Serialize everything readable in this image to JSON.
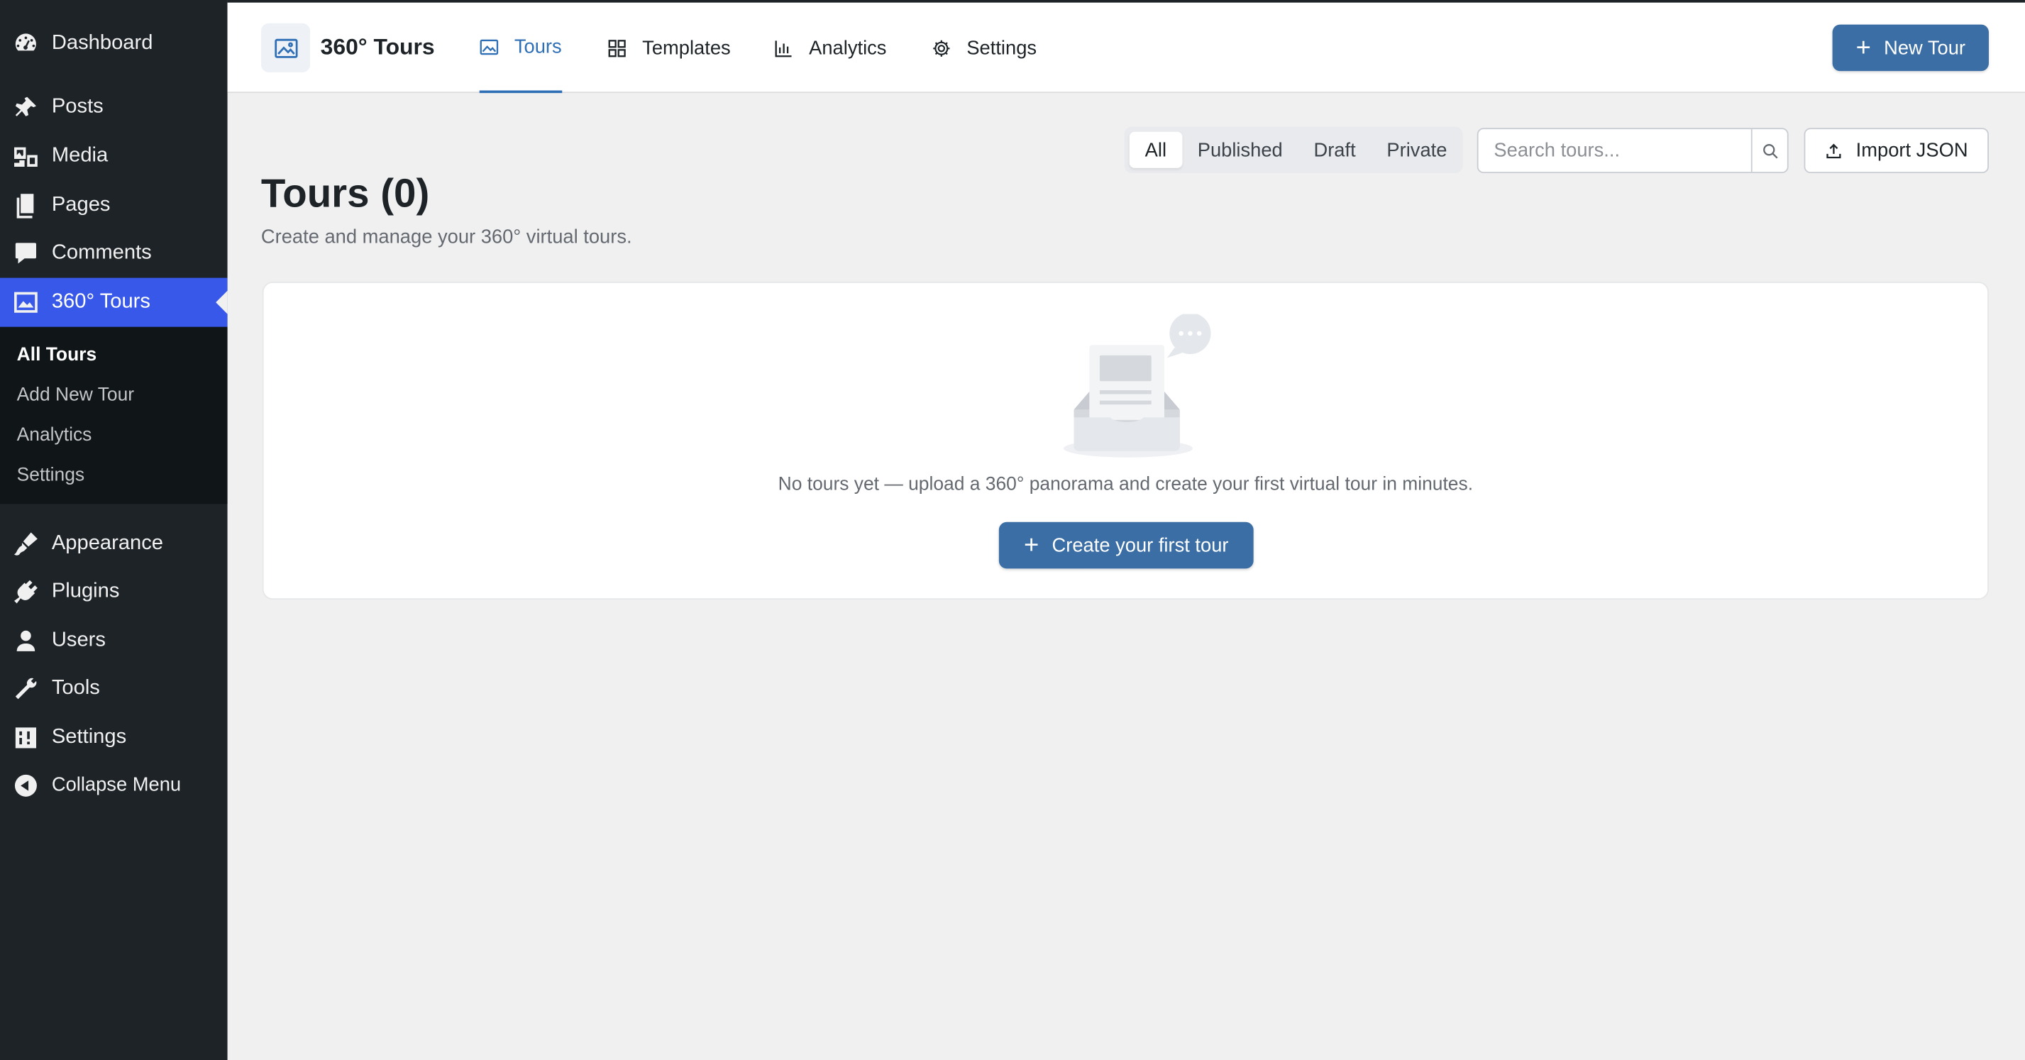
{
  "sidebar": {
    "items": [
      {
        "label": "Dashboard",
        "icon": "dashboard-icon"
      },
      {
        "label": "Posts",
        "icon": "pin-icon"
      },
      {
        "label": "Media",
        "icon": "media-icon"
      },
      {
        "label": "Pages",
        "icon": "pages-icon"
      },
      {
        "label": "Comments",
        "icon": "comments-icon"
      },
      {
        "label": "360° Tours",
        "icon": "image-icon"
      },
      {
        "label": "Appearance",
        "icon": "brush-icon"
      },
      {
        "label": "Plugins",
        "icon": "plugin-icon"
      },
      {
        "label": "Users",
        "icon": "user-icon"
      },
      {
        "label": "Tools",
        "icon": "wrench-icon"
      },
      {
        "label": "Settings",
        "icon": "settings-icon"
      },
      {
        "label": "Collapse Menu",
        "icon": "collapse-icon"
      }
    ],
    "submenu": [
      "All Tours",
      "Add New Tour",
      "Analytics",
      "Settings"
    ]
  },
  "header": {
    "brand": "360° Tours",
    "tabs": [
      {
        "label": "Tours",
        "icon": "image-icon"
      },
      {
        "label": "Templates",
        "icon": "grid-icon"
      },
      {
        "label": "Analytics",
        "icon": "bar-chart-icon"
      },
      {
        "label": "Settings",
        "icon": "gear-icon"
      }
    ],
    "new_tour_label": "New Tour"
  },
  "filters": [
    "All",
    "Published",
    "Draft",
    "Private"
  ],
  "search": {
    "placeholder": "Search tours...",
    "value": ""
  },
  "import_label": "Import JSON",
  "page": {
    "title": "Tours (0)",
    "subtitle": "Create and manage your 360° virtual tours."
  },
  "empty_state": {
    "message": "No tours yet — upload a 360° panorama and create your first virtual tour in minutes.",
    "cta_label": "Create your first tour"
  },
  "colors": {
    "sidebar_bg": "#1d2327",
    "active_menu": "#3858e9",
    "primary_button": "#3a6ea5",
    "active_tab": "#2f6fb5"
  }
}
